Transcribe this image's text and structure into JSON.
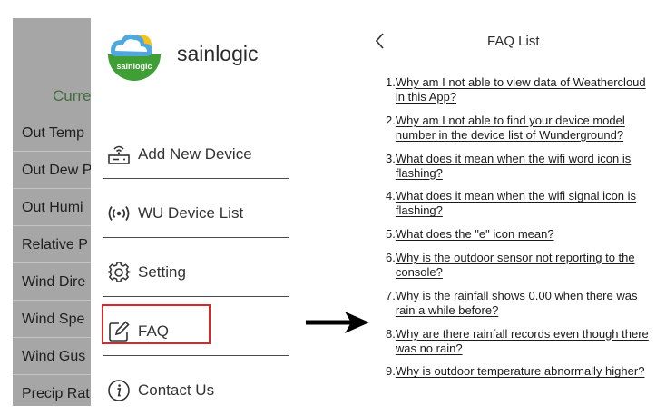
{
  "background": {
    "heading": "Curre",
    "rows": [
      "Out Temp",
      "Out Dew P",
      "Out Humi",
      "Relative P",
      "Wind Dire",
      "Wind Spe",
      "Wind Gus",
      "Precip Rat"
    ]
  },
  "drawer": {
    "logo_text": "sainlogic",
    "brand": "sainlogic",
    "items": [
      {
        "label": "Add New Device",
        "icon": "router-icon"
      },
      {
        "label": "WU Device List",
        "icon": "signal-icon"
      },
      {
        "label": "Setting",
        "icon": "gear-icon"
      },
      {
        "label": "FAQ",
        "icon": "edit-icon"
      },
      {
        "label": "Contact Us",
        "icon": "info-icon"
      }
    ],
    "highlight_color": "#d9262b"
  },
  "faq": {
    "title": "FAQ List",
    "items": [
      {
        "num": "1.",
        "text": "Why am I not able to view data of Weathercloud in this App?"
      },
      {
        "num": "2.",
        "text": "Why am I not able to find your device model number in the device list of Wunderground?"
      },
      {
        "num": "3.",
        "text": "What does it mean when the wifi word icon is flashing?"
      },
      {
        "num": "4.",
        "text": "What does it mean when the wifi signal icon is flashing?"
      },
      {
        "num": "5.",
        "text": "What does the \"e\" icon mean?"
      },
      {
        "num": "6.",
        "text": "Why is the outdoor sensor not reporting to the console?"
      },
      {
        "num": "7.",
        "text": "Why is the rainfall shows 0.00 when there was rain a while before?"
      },
      {
        "num": "8.",
        "text": "Why are there rainfall records even though there was no rain?"
      },
      {
        "num": "9.",
        "text": "Why is outdoor temperature abnormally higher?"
      }
    ]
  }
}
